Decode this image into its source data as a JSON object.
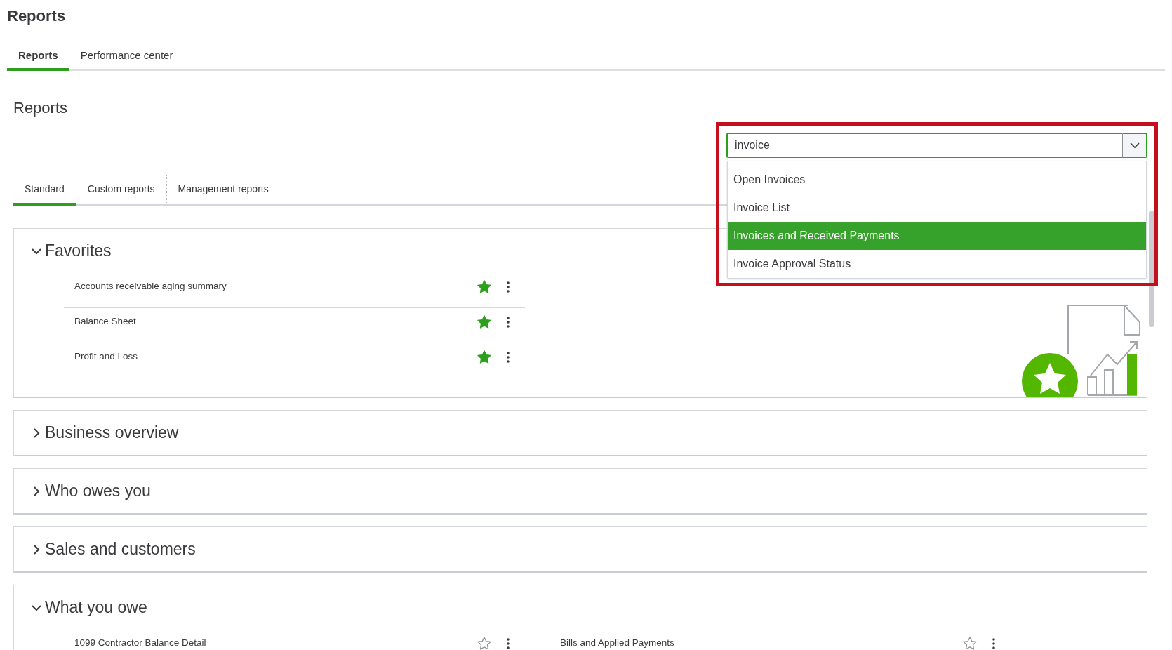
{
  "page_title": "Reports",
  "top_tabs": [
    {
      "label": "Reports",
      "selected": true
    },
    {
      "label": "Performance center",
      "selected": false
    }
  ],
  "heading": "Reports",
  "search": {
    "value": "invoice",
    "suggestions": [
      {
        "label": "Open Invoices",
        "selected": false
      },
      {
        "label": "Invoice List",
        "selected": false
      },
      {
        "label": "Invoices and Received Payments",
        "selected": true
      },
      {
        "label": "Invoice Approval Status",
        "selected": false
      }
    ]
  },
  "sub_tabs": [
    {
      "label": "Standard",
      "selected": true
    },
    {
      "label": "Custom reports",
      "selected": false
    },
    {
      "label": "Management reports",
      "selected": false
    }
  ],
  "sections": [
    {
      "title": "Favorites",
      "expanded": true,
      "kind": "list",
      "reports": [
        {
          "name": "Accounts receivable aging summary",
          "favorite": true
        },
        {
          "name": "Balance Sheet",
          "favorite": true
        },
        {
          "name": "Profit and Loss",
          "favorite": true
        }
      ]
    },
    {
      "title": "Business overview",
      "expanded": false
    },
    {
      "title": "Who owes you",
      "expanded": false
    },
    {
      "title": "Sales and customers",
      "expanded": false
    },
    {
      "title": "What you owe",
      "expanded": true,
      "kind": "grid",
      "reports": [
        {
          "name": "1099 Contractor Balance Detail",
          "favorite": false
        },
        {
          "name": "Bills and Applied Payments",
          "favorite": false
        }
      ]
    }
  ]
}
